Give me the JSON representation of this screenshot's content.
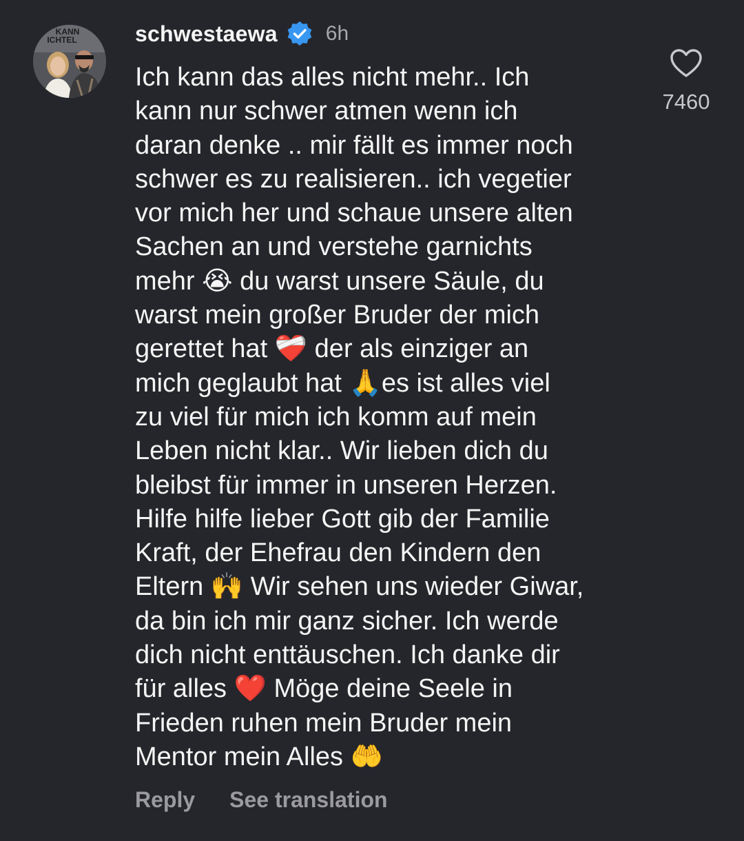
{
  "comment": {
    "avatar_icon": "profile-photo",
    "avatar_overlay_text": "KANN\nICHTEL",
    "username": "schwestaewa",
    "verified_icon": "verified-badge-icon",
    "time_ago": "6h",
    "text": "Ich kann das alles nicht mehr.. Ich\nkann nur schwer atmen wenn ich\ndaran denke .. mir fällt es immer noch\nschwer es zu realisieren.. ich vegetier\nvor mich her und schaue unsere alten\nSachen an und verstehe garnichts\nmehr 😭 du warst unsere Säule, du\nwarst mein großer Bruder der mich\ngerettet hat ❤️‍🩹 der als einziger an\nmich geglaubt hat 🙏es ist alles viel\nzu viel für mich ich komm auf mein\nLeben nicht klar.. Wir lieben dich du\nbleibst für immer in unseren Herzen.\nHilfe hilfe lieber Gott gib der Familie\nKraft, der Ehefrau den Kindern den\nEltern 🙌 Wir sehen uns wieder Giwar,\nda bin ich mir ganz sicher. Ich werde\ndich nicht enttäuschen. Ich danke dir\nfür alles ❤️ Möge deine Seele in\nFrieden ruhen mein Bruder mein\nMentor mein Alles 🤲",
    "like_icon": "heart-outline-icon",
    "like_count": "7460",
    "actions": {
      "reply_label": "Reply",
      "translate_label": "See translation"
    }
  },
  "colors": {
    "background": "#25262b",
    "text": "#f5f5f5",
    "muted": "#a8a8ad",
    "action": "#9a9aa0",
    "verified": "#3897f0"
  }
}
